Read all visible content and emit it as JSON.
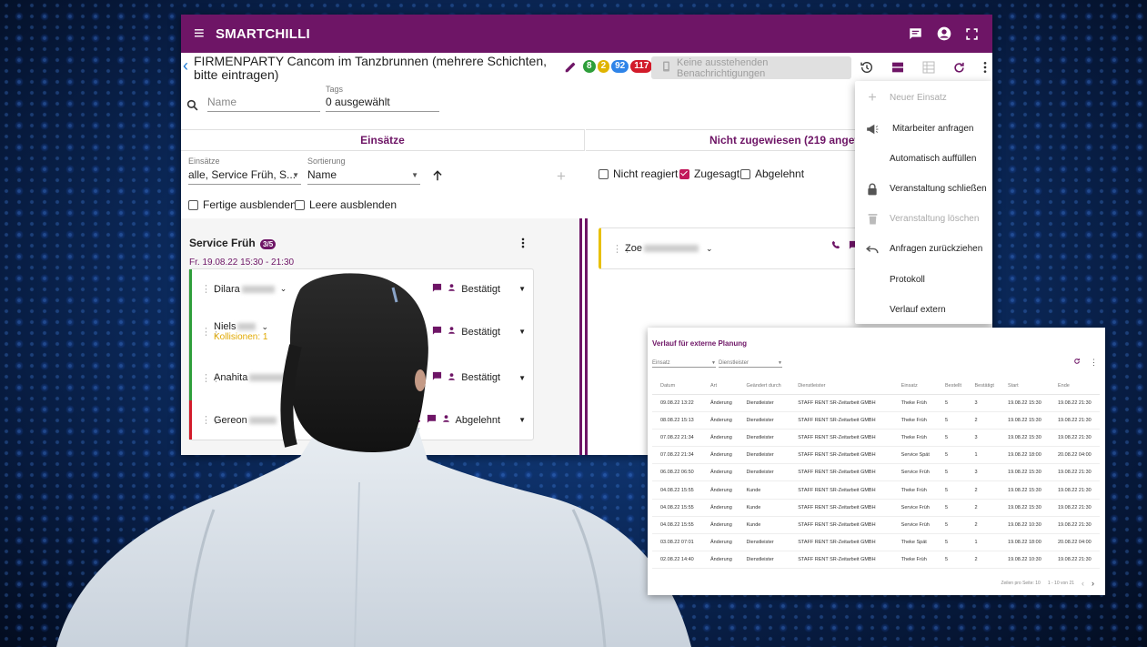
{
  "app": {
    "brand": "SMARTCHILLI",
    "title": "FIRMENPARTY Cancom im Tanzbrunnen (mehrere Schichten, bitte eintragen)",
    "badges": [
      "8",
      "2",
      "92",
      "117"
    ],
    "notif_button": "Keine ausstehenden Benachrichtigungen"
  },
  "search": {
    "name_placeholder": "Name",
    "tags_label": "Tags",
    "tags_value": "0 ausgewählt"
  },
  "left_panel": {
    "header": "Einsätze",
    "einsaetze_label": "Einsätze",
    "einsaetze_value": "alle, Service Früh, S...",
    "sortierung_label": "Sortierung",
    "sortierung_value": "Name",
    "cb_fertige": "Fertige ausblenden",
    "cb_leere": "Leere ausblenden",
    "service_title": "Service Früh",
    "service_count": "3/5",
    "service_time": "Fr. 19.08.22 15:30 - 21:30",
    "employees": [
      {
        "name": "Dilara",
        "status": "Bestätigt",
        "collision": ""
      },
      {
        "name": "Niels",
        "status": "Bestätigt",
        "collision": "Kollisionen: 1"
      },
      {
        "name": "Anahita",
        "status": "Bestätigt",
        "collision": ""
      },
      {
        "name": "Gereon",
        "status": "Abgelehnt",
        "collision": ""
      }
    ]
  },
  "right_panel": {
    "header": "Nicht zugewiesen (219 angefra",
    "cb_nicht": "Nicht reagiert",
    "cb_zugesagt": "Zugesagt",
    "cb_abgelehnt": "Abgelehnt",
    "zoe": "Zoe"
  },
  "menu": {
    "items": [
      {
        "label": "Neuer Einsatz",
        "icon": "plus-icon"
      },
      {
        "label": "Mitarbeiter anfragen",
        "icon": "megaphone-icon"
      },
      {
        "label": "Automatisch auffüllen",
        "icon": ""
      },
      {
        "label": "Veranstaltung schließen",
        "icon": "lock-icon"
      },
      {
        "label": "Veranstaltung löschen",
        "icon": "trash-icon"
      },
      {
        "label": "Anfragen zurückziehen",
        "icon": "undo-icon"
      },
      {
        "label": "Protokoll",
        "icon": ""
      },
      {
        "label": "Verlauf extern",
        "icon": ""
      }
    ]
  },
  "verlauf": {
    "title": "Verlauf für externe Planung",
    "filter_einsatz": "Einsatz",
    "filter_dienstleister": "Dienstleister",
    "columns": [
      "Datum",
      "Art",
      "Geändert durch",
      "Dienstleister",
      "Einsatz",
      "Bestellt",
      "Bestätigt",
      "Start",
      "Ende"
    ],
    "rows": [
      [
        "09.08.22 13:22",
        "Änderung",
        "Dienstleister",
        "STAFF RENT SR-Zeitarbeit GMBH",
        "Theke Früh",
        "5",
        "3",
        "19.08.22 15:30",
        "19.08.22 21:30"
      ],
      [
        "08.08.22 15:13",
        "Änderung",
        "Dienstleister",
        "STAFF RENT SR-Zeitarbeit GMBH",
        "Theke Früh",
        "5",
        "2",
        "19.08.22 15:30",
        "19.08.22 21:30"
      ],
      [
        "07.08.22 21:34",
        "Änderung",
        "Dienstleister",
        "STAFF RENT SR-Zeitarbeit GMBH",
        "Theke Früh",
        "5",
        "3",
        "19.08.22 15:30",
        "19.08.22 21:30"
      ],
      [
        "07.08.22 21:34",
        "Änderung",
        "Dienstleister",
        "STAFF RENT SR-Zeitarbeit GMBH",
        "Service Spät",
        "5",
        "1",
        "19.08.22 18:00",
        "20.08.22 04:00"
      ],
      [
        "06.08.22 06:50",
        "Änderung",
        "Dienstleister",
        "STAFF RENT SR-Zeitarbeit GMBH",
        "Service Früh",
        "5",
        "3",
        "19.08.22 15:30",
        "19.08.22 21:30"
      ],
      [
        "04.08.22 15:55",
        "Änderung",
        "Kunde",
        "STAFF RENT SR-Zeitarbeit GMBH",
        "Theke Früh",
        "5",
        "2",
        "19.08.22 15:30",
        "19.08.22 21:30"
      ],
      [
        "04.08.22 15:55",
        "Änderung",
        "Kunde",
        "STAFF RENT SR-Zeitarbeit GMBH",
        "Service Früh",
        "5",
        "2",
        "19.08.22 15:30",
        "19.08.22 21:30"
      ],
      [
        "04.08.22 15:55",
        "Änderung",
        "Kunde",
        "STAFF RENT SR-Zeitarbeit GMBH",
        "Service Früh",
        "5",
        "2",
        "19.08.22 10:30",
        "19.08.22 21:30"
      ],
      [
        "03.08.22 07:01",
        "Änderung",
        "Dienstleister",
        "STAFF RENT SR-Zeitarbeit GMBH",
        "Theke Spät",
        "5",
        "1",
        "19.08.22 18:00",
        "20.08.22 04:00"
      ],
      [
        "02.08.22 14:40",
        "Änderung",
        "Dienstleister",
        "STAFF RENT SR-Zeitarbeit GMBH",
        "Theke Früh",
        "5",
        "2",
        "19.08.22 10:30",
        "19.08.22 21:30"
      ]
    ],
    "rows_per_page": "Zeilen pro Seite: 10",
    "range": "1 - 10 von 21"
  },
  "colors": {
    "primary": "#6e1566",
    "accent": "#c2185b"
  }
}
